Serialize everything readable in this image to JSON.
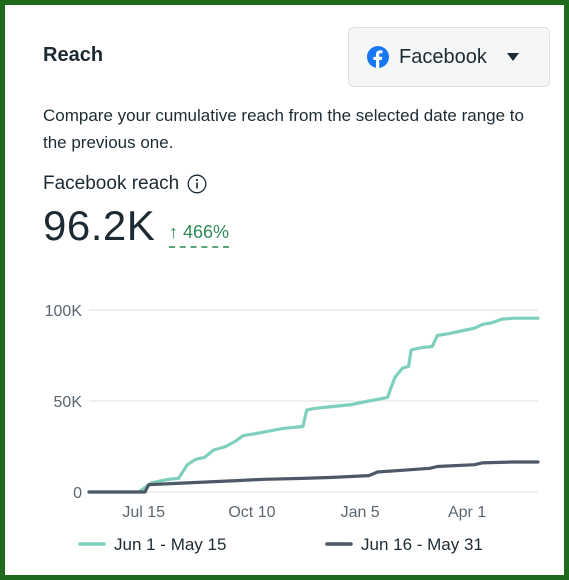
{
  "card": {
    "title": "Reach",
    "platform_selector": {
      "label": "Facebook",
      "icon": "facebook-icon"
    },
    "description": "Compare your cumulative reach from the selected date range to the previous one.",
    "metric": {
      "label": "Facebook reach",
      "value": "96.2K",
      "change": "↑ 466%",
      "change_color": "#2e8b57"
    }
  },
  "colors": {
    "frame": "#1e6b1e",
    "current_series": "#7fcfbd",
    "previous_series": "#4d5966",
    "gridline": "#e3e6e8"
  },
  "chart_data": {
    "type": "line",
    "ylim": [
      0,
      100000
    ],
    "yticks": [
      0,
      50000,
      100000
    ],
    "ytick_labels": [
      "0",
      "50K",
      "100K"
    ],
    "xlim_days": [
      0,
      361
    ],
    "xtick_labels": [
      "Jul 15",
      "Oct 10",
      "Jan 5",
      "Apr 1"
    ],
    "xtick_days": [
      44,
      131,
      218,
      304
    ],
    "grid": true,
    "legend_position": "bottom",
    "series": [
      {
        "name": "Jun 1 - May 15",
        "color": "#7fcfbd",
        "points": [
          [
            0,
            0
          ],
          [
            40,
            0
          ],
          [
            44,
            2000
          ],
          [
            50,
            5000
          ],
          [
            57,
            6000
          ],
          [
            64,
            7000
          ],
          [
            72,
            7500
          ],
          [
            79,
            15000
          ],
          [
            86,
            18000
          ],
          [
            93,
            19000
          ],
          [
            100,
            23000
          ],
          [
            110,
            25000
          ],
          [
            118,
            28000
          ],
          [
            124,
            31000
          ],
          [
            133,
            32000
          ],
          [
            141,
            33000
          ],
          [
            149,
            34000
          ],
          [
            157,
            35000
          ],
          [
            172,
            36000
          ],
          [
            175,
            45000
          ],
          [
            182,
            46000
          ],
          [
            196,
            47000
          ],
          [
            211,
            48000
          ],
          [
            225,
            50000
          ],
          [
            240,
            52000
          ],
          [
            246,
            63000
          ],
          [
            252,
            68000
          ],
          [
            257,
            69000
          ],
          [
            259,
            78000
          ],
          [
            265,
            79000
          ],
          [
            270,
            79500
          ],
          [
            276,
            80000
          ],
          [
            280,
            86000
          ],
          [
            289,
            87000
          ],
          [
            296,
            88000
          ],
          [
            303,
            89000
          ],
          [
            310,
            90000
          ],
          [
            316,
            92000
          ],
          [
            324,
            93000
          ],
          [
            332,
            95000
          ],
          [
            342,
            95500
          ],
          [
            361,
            95500
          ]
        ]
      },
      {
        "name": "Jun 16 - May 31",
        "color": "#4d5966",
        "points": [
          [
            0,
            0
          ],
          [
            45,
            0
          ],
          [
            48,
            4000
          ],
          [
            79,
            5000
          ],
          [
            110,
            6000
          ],
          [
            141,
            7000
          ],
          [
            172,
            7500
          ],
          [
            196,
            8000
          ],
          [
            225,
            9000
          ],
          [
            232,
            11000
          ],
          [
            253,
            12000
          ],
          [
            274,
            13000
          ],
          [
            280,
            14000
          ],
          [
            310,
            15000
          ],
          [
            316,
            16000
          ],
          [
            340,
            16500
          ],
          [
            361,
            16500
          ]
        ]
      }
    ]
  }
}
